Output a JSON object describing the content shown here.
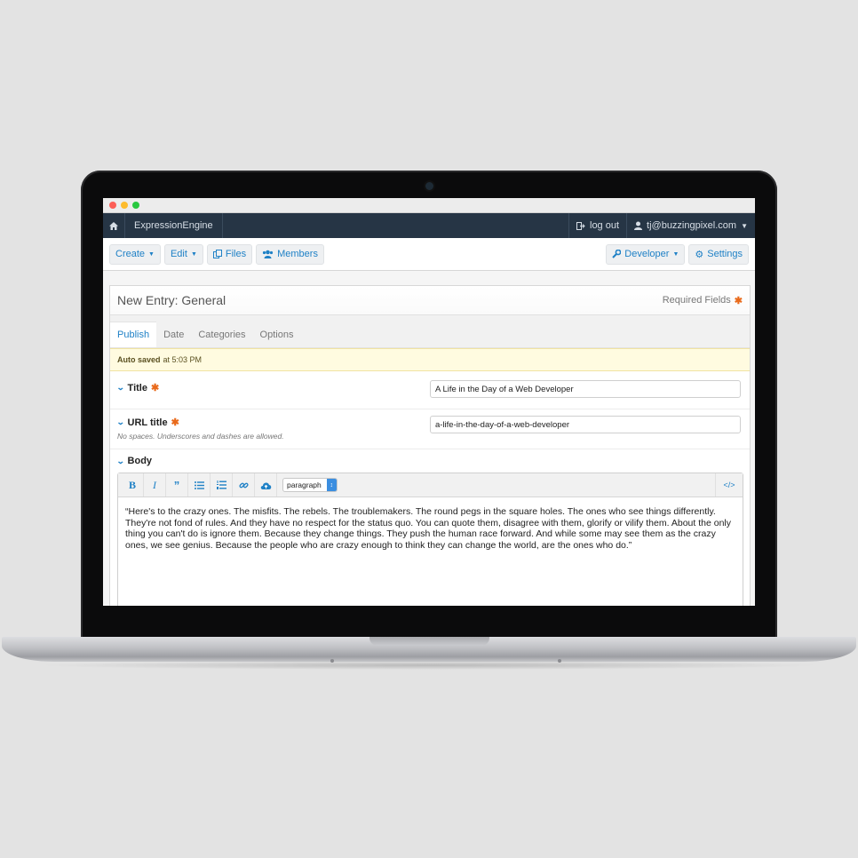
{
  "window": {
    "traffic_lights": [
      "red",
      "yellow",
      "green"
    ]
  },
  "navbar": {
    "brand": "ExpressionEngine",
    "logout_label": "log out",
    "user_email": "tj@buzzingpixel.com"
  },
  "toolbar": {
    "create": "Create",
    "edit": "Edit",
    "files": "Files",
    "members": "Members",
    "developer": "Developer",
    "settings": "Settings"
  },
  "panel": {
    "title": "New Entry: General",
    "required_label": "Required Fields",
    "required_marker": "✱"
  },
  "tabs": [
    {
      "label": "Publish",
      "active": true
    },
    {
      "label": "Date",
      "active": false
    },
    {
      "label": "Categories",
      "active": false
    },
    {
      "label": "Options",
      "active": false
    }
  ],
  "alert": {
    "strong": "Auto saved",
    "text": "at 5:03 PM"
  },
  "fields": {
    "title": {
      "label": "Title",
      "value": "A Life in the Day of a Web Developer"
    },
    "url_title": {
      "label": "URL title",
      "note": "No spaces. Underscores and dashes are allowed.",
      "value": "a-life-in-the-day-of-a-web-developer"
    },
    "body": {
      "label": "Body",
      "format": "paragraph",
      "text": "“Here's to the crazy ones. The misfits. The rebels. The troublemakers. The round pegs in the square holes. The ones who see things differently. They're not fond of rules. And they have no respect for the status quo. You can quote them, disagree with them, glorify or vilify them. About the only thing you can't do is ignore them. Because they change things. They push the human race forward. And while some may see them as the crazy ones, we see genius. Because the people who are crazy enough to think they can change the world, are the ones who do.”"
    }
  },
  "editor_tools": [
    "bold-icon",
    "italic-icon",
    "quote-icon",
    "bullet-list-icon",
    "ordered-list-icon",
    "link-icon",
    "upload-icon",
    "source-code-icon"
  ],
  "colors": {
    "accent": "#1f81c6",
    "navbar": "#263545",
    "required": "#e96a1b"
  }
}
